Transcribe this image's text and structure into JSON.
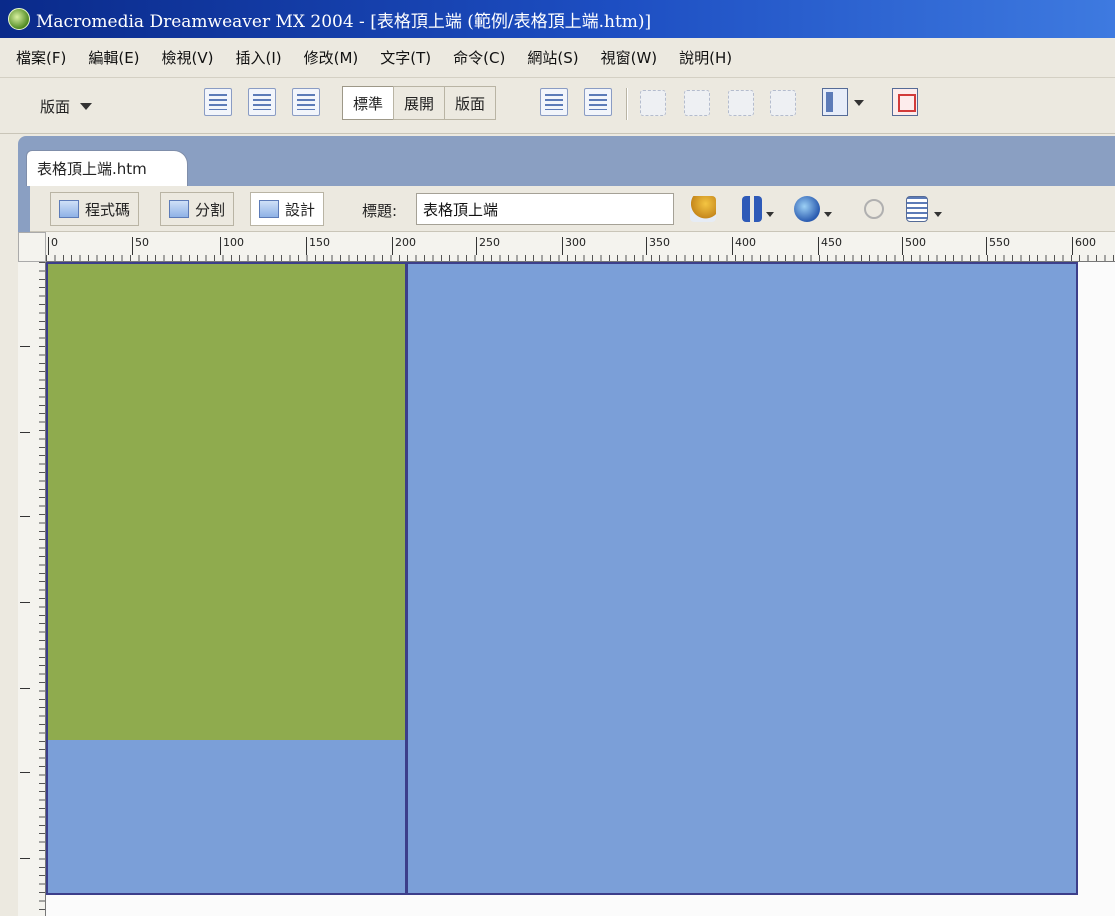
{
  "window": {
    "title": "Macromedia Dreamweaver MX 2004 - [表格頂上端 (範例/表格頂上端.htm)]"
  },
  "menu": [
    "檔案(F)",
    "編輯(E)",
    "檢視(V)",
    "插入(I)",
    "修改(M)",
    "文字(T)",
    "命令(C)",
    "網站(S)",
    "視窗(W)",
    "說明(H)"
  ],
  "insert_bar": {
    "category": "版面",
    "modes": [
      "標準",
      "展開",
      "版面"
    ],
    "active_mode": "標準"
  },
  "document": {
    "tab": "表格頂上端.htm",
    "views": {
      "code": "程式碼",
      "split": "分割",
      "design": "設計"
    },
    "active_view": "設計",
    "title_label": "標題:",
    "title_value": "表格頂上端"
  },
  "ruler": {
    "horizontal_marks": [
      "0",
      "50",
      "100",
      "150",
      "200",
      "250",
      "300",
      "350",
      "400",
      "450",
      "500",
      "550",
      "600"
    ]
  },
  "colors": {
    "left_top_cell": "#8fab4e",
    "table_bg": "#7b9fd8",
    "table_border": "#3c3e8a"
  }
}
